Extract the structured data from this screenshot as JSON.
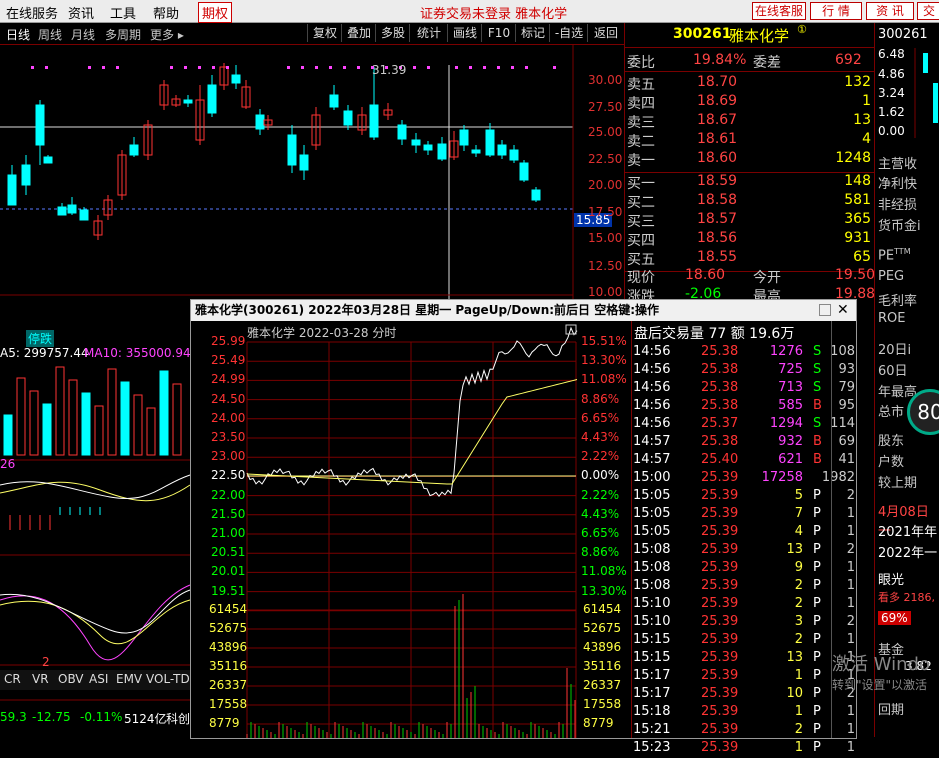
{
  "menubar": {
    "items": [
      "在线服务",
      "资讯",
      "工具",
      "帮助"
    ],
    "qiquan": "期权",
    "status": "证券交易未登录 雅本化学",
    "buttons": [
      "在线客服",
      "行 情",
      "资 讯",
      "交"
    ]
  },
  "toolbar": {
    "periods": [
      "日线",
      "周线",
      "月线",
      "多周期",
      "更多 ▸"
    ],
    "tools": [
      "复权",
      "叠加",
      "多股",
      "统计",
      "画线",
      "F10",
      "标记",
      "-自选",
      "返回"
    ]
  },
  "kline": {
    "high_label": "31.39",
    "last_label": "15.85",
    "y_ticks": [
      "30.00",
      "27.50",
      "25.00",
      "22.50",
      "20.00",
      "17.50",
      "15.00",
      "12.50",
      "10.00"
    ],
    "limit_label": "停跌",
    "vol_ma": "A5: 299757.44",
    "vol_ma10": "MA10: 355000.94",
    "macd_label": "26",
    "bottom_tabs": [
      "CR",
      "VR",
      "OBV",
      "ASI",
      "EMV",
      "VOL-TD"
    ],
    "bottom_stats": [
      "59.3",
      "-12.75",
      "-0.11%",
      "5124亿",
      "科创"
    ],
    "num2": "2"
  },
  "quote": {
    "code": "300261",
    "name": "雅本化学",
    "weibi_label": "委比",
    "weibi": "19.84%",
    "weicha_label": "委差",
    "weicha": "692",
    "asks": [
      {
        "l": "卖五",
        "p": "18.70",
        "v": "132"
      },
      {
        "l": "卖四",
        "p": "18.69",
        "v": "1"
      },
      {
        "l": "卖三",
        "p": "18.67",
        "v": "13"
      },
      {
        "l": "卖二",
        "p": "18.61",
        "v": "4"
      },
      {
        "l": "卖一",
        "p": "18.60",
        "v": "1248"
      }
    ],
    "bids": [
      {
        "l": "买一",
        "p": "18.59",
        "v": "148"
      },
      {
        "l": "买二",
        "p": "18.58",
        "v": "581"
      },
      {
        "l": "买三",
        "p": "18.57",
        "v": "365"
      },
      {
        "l": "买四",
        "p": "18.56",
        "v": "931"
      },
      {
        "l": "买五",
        "p": "18.55",
        "v": "65"
      }
    ],
    "now_label": "现价",
    "now": "18.60",
    "open_label": "今开",
    "open": "19.50",
    "chg_label": "涨跌",
    "chg": "-2.06",
    "high_label": "最高",
    "high": "19.88"
  },
  "far": {
    "code": "300261",
    "vals": [
      "6.48",
      "4.86",
      "3.24",
      "1.62",
      "0.00"
    ],
    "labels": [
      "主营收",
      "净利快",
      "非经损",
      "货币金i",
      "PE",
      "PEG",
      "毛利率",
      "ROE",
      "20日i",
      "60日",
      "年最高",
      "总市",
      "股东",
      "户数",
      "较上期",
      "4月08日一",
      "2021年年",
      "2022年一",
      "眼光",
      "看多 2186,",
      "69%",
      "基金",
      "3.82",
      "回期"
    ],
    "pe_sup": "TTM",
    "score": "80"
  },
  "popup": {
    "title": "雅本化学(300261)  2022年03月28日 星期一  PageUp/Down:前后日 空格键:操作",
    "chart_title": "雅本化学  2022-03-28 分时",
    "left_ticks": [
      "25.99",
      "25.49",
      "24.99",
      "24.50",
      "24.00",
      "23.50",
      "23.00",
      "22.50",
      "22.00",
      "21.50",
      "21.00",
      "20.51",
      "20.01",
      "19.51"
    ],
    "right_ticks": [
      "15.51%",
      "13.30%",
      "11.08%",
      "8.86%",
      "6.65%",
      "4.43%",
      "2.22%",
      "0.00%",
      "2.22%",
      "4.43%",
      "6.65%",
      "8.86%",
      "11.08%",
      "13.30%"
    ],
    "vol_ticks": [
      "61454",
      "52675",
      "43896",
      "35116",
      "26337",
      "17558",
      "8779"
    ],
    "trade_header": "盘后交易量 77 额 19.6万",
    "trades": [
      [
        "14:56",
        "25.38",
        "1276",
        "S",
        "108"
      ],
      [
        "14:56",
        "25.38",
        "725",
        "S",
        "93"
      ],
      [
        "14:56",
        "25.38",
        "713",
        "S",
        "79"
      ],
      [
        "14:56",
        "25.38",
        "585",
        "B",
        "95"
      ],
      [
        "14:56",
        "25.37",
        "1294",
        "S",
        "114"
      ],
      [
        "14:57",
        "25.38",
        "932",
        "B",
        "69"
      ],
      [
        "14:57",
        "25.40",
        "621",
        "B",
        "41"
      ],
      [
        "15:00",
        "25.39",
        "17258",
        "",
        "1982"
      ],
      [
        "15:05",
        "25.39",
        "5",
        "P",
        "2"
      ],
      [
        "15:05",
        "25.39",
        "7",
        "P",
        "1"
      ],
      [
        "15:05",
        "25.39",
        "4",
        "P",
        "1"
      ],
      [
        "15:08",
        "25.39",
        "13",
        "P",
        "2"
      ],
      [
        "15:08",
        "25.39",
        "9",
        "P",
        "1"
      ],
      [
        "15:08",
        "25.39",
        "2",
        "P",
        "1"
      ],
      [
        "15:10",
        "25.39",
        "2",
        "P",
        "1"
      ],
      [
        "15:10",
        "25.39",
        "3",
        "P",
        "2"
      ],
      [
        "15:15",
        "25.39",
        "2",
        "P",
        "1"
      ],
      [
        "15:15",
        "25.39",
        "13",
        "P",
        "1"
      ],
      [
        "15:17",
        "25.39",
        "1",
        "P",
        "1"
      ],
      [
        "15:17",
        "25.39",
        "10",
        "P",
        "2"
      ],
      [
        "15:18",
        "25.39",
        "1",
        "P",
        "1"
      ],
      [
        "15:21",
        "25.39",
        "2",
        "P",
        "1"
      ],
      [
        "15:23",
        "25.39",
        "1",
        "P",
        "1"
      ]
    ]
  },
  "watermark": {
    "line1": "激活 Windo",
    "line2": "转到\"设置\"以激活"
  },
  "colors": {
    "up": "#ff3333",
    "down": "#00ffff",
    "bg": "#000000",
    "grid": "#7a0000"
  }
}
